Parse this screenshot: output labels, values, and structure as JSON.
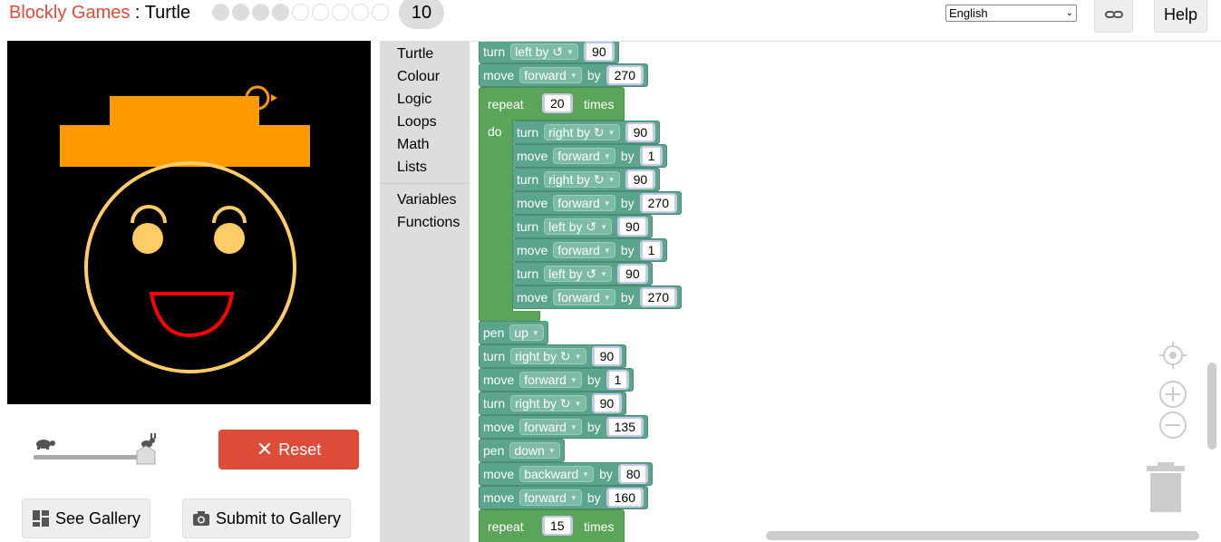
{
  "header": {
    "brand": "Blockly Games",
    "separator": " : ",
    "game": "Turtle",
    "level": "10",
    "language": "English",
    "help": "Help",
    "link_icon": "link-icon"
  },
  "progress": {
    "completed_levels": 4,
    "total_levels": 9
  },
  "controls": {
    "reset": "Reset",
    "see_gallery": "See Gallery",
    "submit_gallery": "Submit to Gallery",
    "speed_value": 1.0,
    "slow_icon": "turtle-icon",
    "fast_icon": "rabbit-icon"
  },
  "toolbox": {
    "items": [
      "Turtle",
      "Colour",
      "Logic",
      "Loops",
      "Math",
      "Lists"
    ],
    "items2": [
      "Variables",
      "Functions"
    ]
  },
  "blocks": {
    "b1": {
      "kw": "turn",
      "opt": "left by ↺",
      "val": "90"
    },
    "b2": {
      "kw": "move",
      "opt": "forward",
      "by": "by",
      "val": "270"
    },
    "rep1": {
      "kw": "repeat",
      "val": "20",
      "times": "times",
      "do": "do"
    },
    "i1": {
      "kw": "turn",
      "opt": "right by ↻",
      "val": "90"
    },
    "i2": {
      "kw": "move",
      "opt": "forward",
      "by": "by",
      "val": "1"
    },
    "i3": {
      "kw": "turn",
      "opt": "right by ↻",
      "val": "90"
    },
    "i4": {
      "kw": "move",
      "opt": "forward",
      "by": "by",
      "val": "270"
    },
    "i5": {
      "kw": "turn",
      "opt": "left by ↺",
      "val": "90"
    },
    "i6": {
      "kw": "move",
      "opt": "forward",
      "by": "by",
      "val": "1"
    },
    "i7": {
      "kw": "turn",
      "opt": "left by ↺",
      "val": "90"
    },
    "i8": {
      "kw": "move",
      "opt": "forward",
      "by": "by",
      "val": "270"
    },
    "c1": {
      "kw": "pen",
      "opt": "up"
    },
    "c2": {
      "kw": "turn",
      "opt": "right by ↻",
      "val": "90"
    },
    "c3": {
      "kw": "move",
      "opt": "forward",
      "by": "by",
      "val": "1"
    },
    "c4": {
      "kw": "turn",
      "opt": "right by ↻",
      "val": "90"
    },
    "c5": {
      "kw": "move",
      "opt": "forward",
      "by": "by",
      "val": "135"
    },
    "c6": {
      "kw": "pen",
      "opt": "down"
    },
    "c7": {
      "kw": "move",
      "opt": "backward",
      "by": "by",
      "val": "80"
    },
    "c8": {
      "kw": "move",
      "opt": "forward",
      "by": "by",
      "val": "160"
    },
    "rep2": {
      "kw": "repeat",
      "val": "15",
      "times": "times"
    }
  },
  "workspace_icons": [
    "recenter-icon",
    "zoom-in-icon",
    "zoom-out-icon",
    "trash-icon"
  ],
  "colors": {
    "brand_red": "#dd4b39",
    "turtle_block": "#5ba58c",
    "loop_block": "#5ba55b",
    "hat": "#ff9900",
    "face": "#ffcc66",
    "mouth": "#ff0000"
  }
}
